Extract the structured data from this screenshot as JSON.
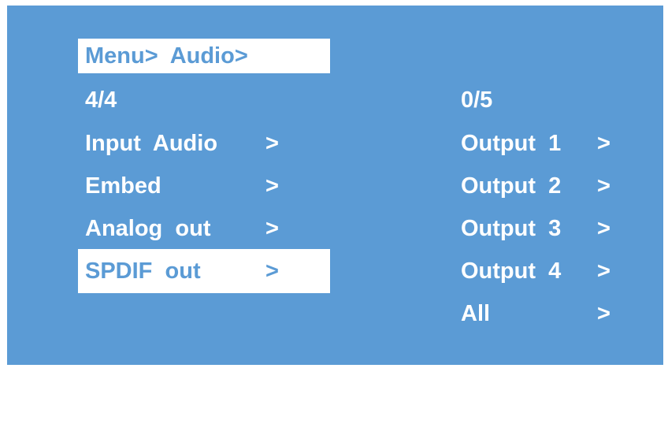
{
  "breadcrumb": "Menu>  Audio>",
  "left_menu": {
    "page_indicator": "4/4",
    "items": [
      {
        "label": "Input  Audio",
        "arrow": ">"
      },
      {
        "label": "Embed",
        "arrow": ">"
      },
      {
        "label": "Analog  out",
        "arrow": ">"
      },
      {
        "label": "SPDIF  out",
        "arrow": ">",
        "selected": true
      }
    ]
  },
  "right_menu": {
    "page_indicator": "0/5",
    "items": [
      {
        "label": "Output  1",
        "arrow": ">"
      },
      {
        "label": "Output  2",
        "arrow": ">"
      },
      {
        "label": "Output  3",
        "arrow": ">"
      },
      {
        "label": "Output  4",
        "arrow": ">"
      },
      {
        "label": "All",
        "arrow": ">"
      }
    ]
  },
  "colors": {
    "background": "#5b9bd5",
    "text": "#ffffff",
    "highlight_bg": "#ffffff",
    "highlight_text": "#5b9bd5"
  }
}
